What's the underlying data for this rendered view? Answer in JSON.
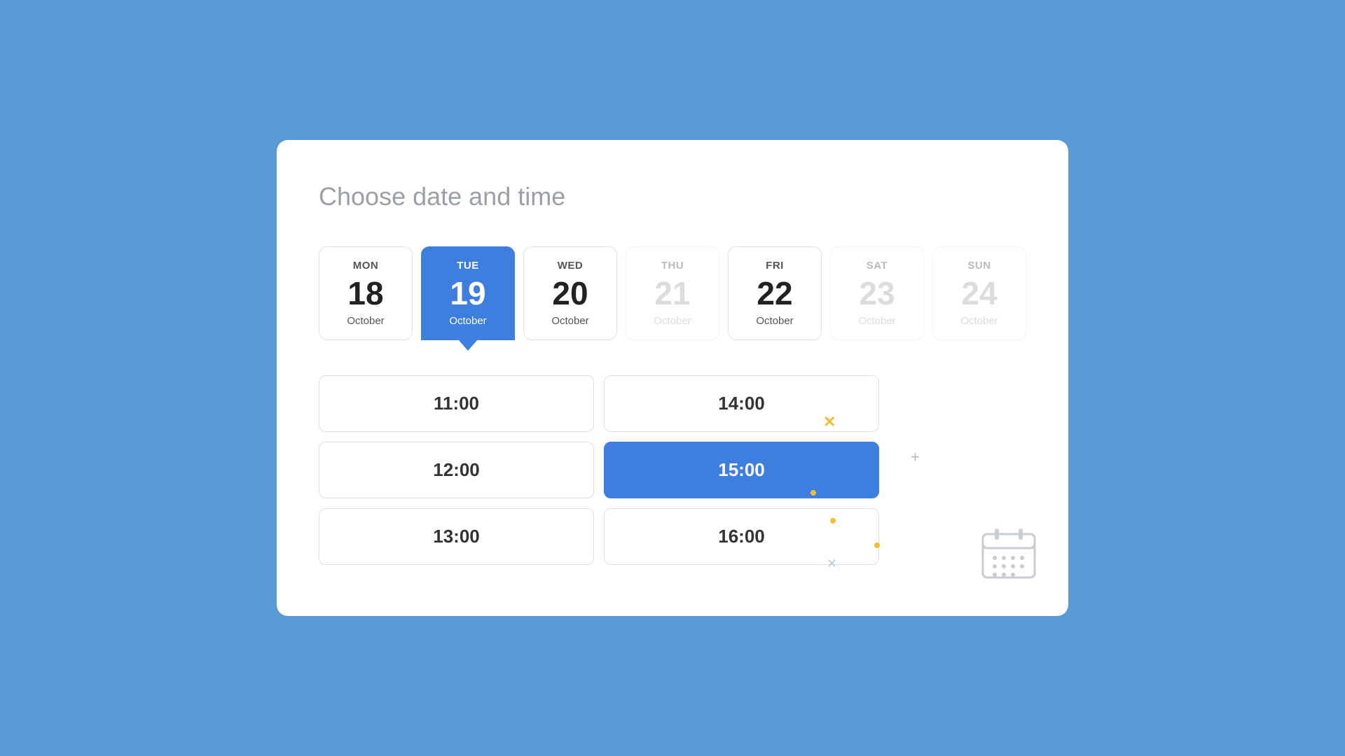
{
  "page": {
    "title": "Choose date and time"
  },
  "dates": [
    {
      "id": "mon",
      "dayName": "MON",
      "dayNum": "18",
      "month": "October",
      "active": false,
      "disabled": false
    },
    {
      "id": "tue",
      "dayName": "TUE",
      "dayNum": "19",
      "month": "October",
      "active": true,
      "disabled": false
    },
    {
      "id": "wed",
      "dayName": "WED",
      "dayNum": "20",
      "month": "October",
      "active": false,
      "disabled": false
    },
    {
      "id": "thu",
      "dayName": "THU",
      "dayNum": "21",
      "month": "October",
      "active": false,
      "disabled": true
    },
    {
      "id": "fri",
      "dayName": "FRI",
      "dayNum": "22",
      "month": "October",
      "active": false,
      "disabled": false
    },
    {
      "id": "sat",
      "dayName": "SAT",
      "dayNum": "23",
      "month": "October",
      "active": false,
      "disabled": true
    },
    {
      "id": "sun",
      "dayName": "SUN",
      "dayNum": "24",
      "month": "October",
      "active": false,
      "disabled": true
    }
  ],
  "times": [
    {
      "id": "t1100",
      "label": "11:00",
      "active": false
    },
    {
      "id": "t1400",
      "label": "14:00",
      "active": false
    },
    {
      "id": "t1200",
      "label": "12:00",
      "active": false
    },
    {
      "id": "t1500",
      "label": "15:00",
      "active": true
    },
    {
      "id": "t1300",
      "label": "13:00",
      "active": false
    },
    {
      "id": "t1600",
      "label": "16:00",
      "active": false
    }
  ]
}
